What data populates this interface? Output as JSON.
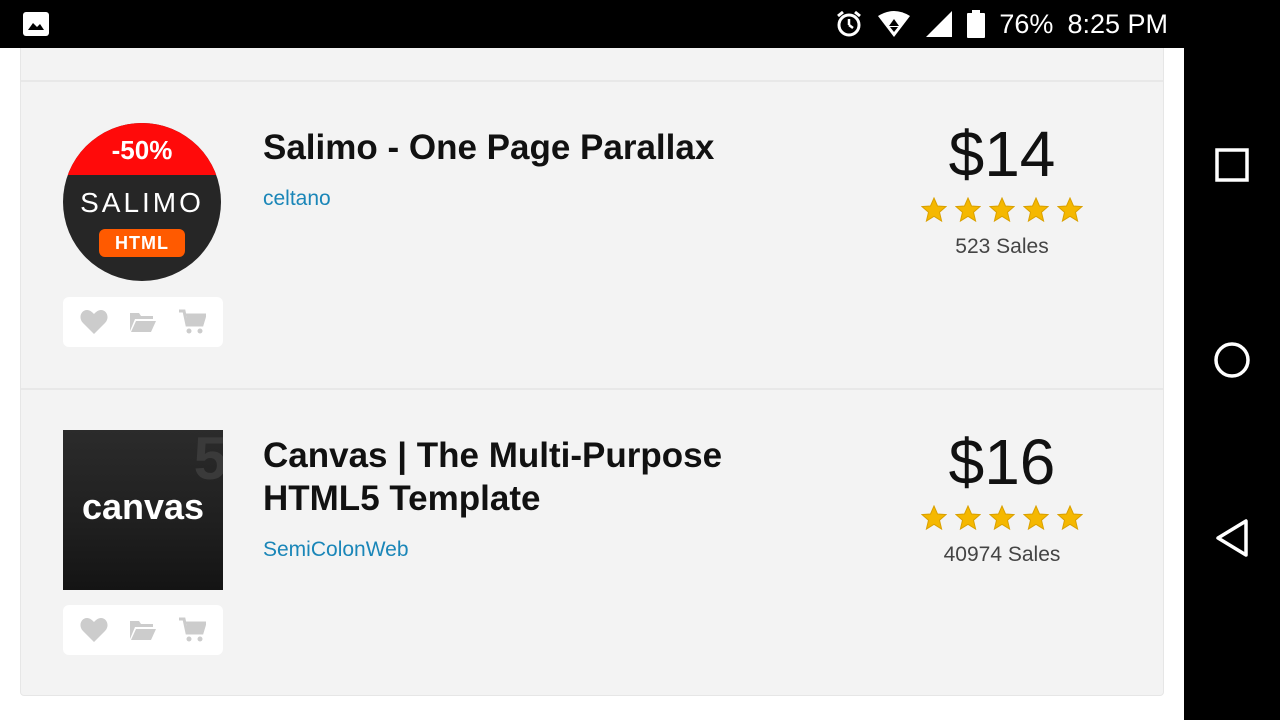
{
  "status_bar": {
    "battery_percent": "76%",
    "time": "8:25 PM",
    "icons": [
      "image-icon",
      "alarm-icon",
      "wifi-icon",
      "cellular-icon",
      "battery-icon"
    ]
  },
  "nav_bar": {
    "buttons": [
      "recents-icon",
      "home-icon",
      "back-icon"
    ]
  },
  "items": [
    {
      "title": "Salimo - One Page Parallax",
      "author": "celtano",
      "price": "$14",
      "rating_stars": 5,
      "sales": "523 Sales",
      "thumbnail": {
        "discount": "-50%",
        "brand": "SALIMO",
        "tag": "HTML",
        "band_color": "#ff0a0a",
        "tag_color": "#ff5a00"
      }
    },
    {
      "title": "Canvas | The Multi-Purpose HTML5 Template",
      "author": "SemiColonWeb",
      "price": "$16",
      "rating_stars": 5,
      "sales": "40974 Sales",
      "thumbnail": {
        "word": "canvas",
        "corner_glyph": "5"
      }
    }
  ],
  "actions": [
    "heart-icon",
    "folder-icon",
    "cart-icon"
  ],
  "colors": {
    "author_link": "#1a86b8",
    "star": "#f5b800",
    "card_bg": "#f3f3f3"
  }
}
